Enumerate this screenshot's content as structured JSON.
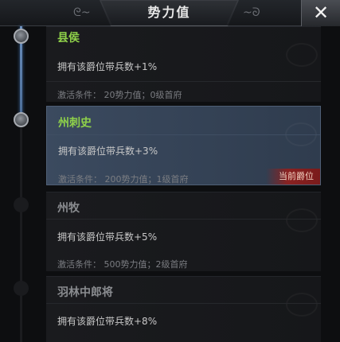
{
  "header": {
    "title": "势力值",
    "close_label": "✕"
  },
  "ranks": [
    {
      "name": "县侯",
      "benefit": "拥有该爵位带兵数+1%",
      "condition": "激活条件： 20势力值；0级首府",
      "state": "reached",
      "color": "#8fd14a"
    },
    {
      "name": "州刺史",
      "benefit": "拥有该爵位带兵数+3%",
      "condition": "激活条件： 200势力值；1级首府",
      "state": "current",
      "color": "#8fd14a",
      "badge": "当前爵位"
    },
    {
      "name": "州牧",
      "benefit": "拥有该爵位带兵数+5%",
      "condition": "激活条件： 500势力值；2级首府",
      "state": "locked",
      "color": "#8a8c90"
    },
    {
      "name": "羽林中郎将",
      "benefit": "拥有该爵位带兵数+8%",
      "condition": "",
      "state": "locked",
      "color": "#8a8c90"
    }
  ]
}
